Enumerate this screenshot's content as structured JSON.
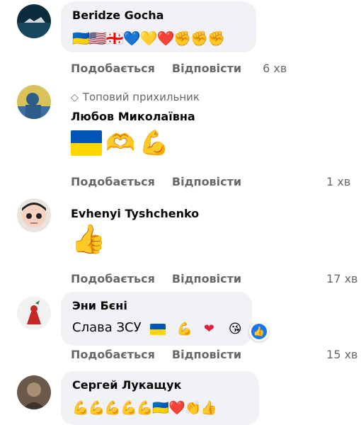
{
  "comments": [
    {
      "author": "Beridze Gocha",
      "emojis": "🇺🇦🇺🇸🇬🇪💙💛❤️✊✊✊",
      "like_label": "Подобається",
      "reply_label": "Відповісти",
      "time": "6 хв"
    },
    {
      "badge": "Топовий прихильник",
      "author": "Любов Миколаївна",
      "emojis": "🇺🇦🫶💪",
      "like_label": "Подобається",
      "reply_label": "Відповісти",
      "time": "1 хв"
    },
    {
      "author": "Evhenyi Tyshchenko",
      "emojis": "👍",
      "like_label": "Подобається",
      "reply_label": "Відповісти",
      "time": "17 хв"
    },
    {
      "author": "Эни Бєні",
      "text": "Слава ЗСУ",
      "emojis": "🇺🇦💪❤️😘",
      "reaction": "like",
      "like_label": "Подобається",
      "reply_label": "Відповісти",
      "time": "15 хв"
    },
    {
      "author": "Сергей Лукащук",
      "emojis": "💪💪💪💪💪🇺🇦❤️👏👍"
    }
  ],
  "colors": {
    "bubble": "#f0f2f5",
    "muted": "#65676b",
    "like_blue": "#1877f2"
  }
}
